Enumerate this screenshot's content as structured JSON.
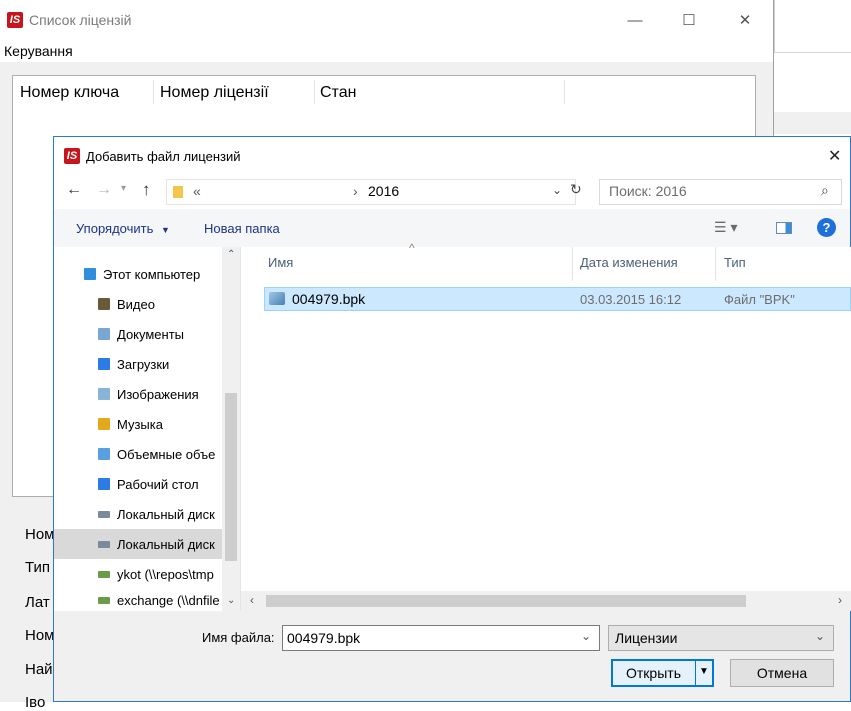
{
  "parent_window": {
    "title": "Список ліцензій",
    "menu": [
      "Керування"
    ],
    "columns": [
      "Номер ключа",
      "Номер ліцензії",
      "Стан"
    ],
    "field_labels": [
      "Ном",
      "Тип",
      "Лат",
      "Ном",
      "Най",
      "Іво"
    ],
    "caption_buttons": {
      "minimize": "—",
      "maximize": "☐",
      "close": "✕"
    }
  },
  "dialog": {
    "title": "Добавить файл лицензий",
    "close": "✕",
    "address": {
      "prefix": "«",
      "separator": "›",
      "current": "2016",
      "search_placeholder": "Поиск: 2016"
    },
    "toolbar": {
      "organize": "Упорядочить",
      "new_folder": "Новая папка"
    },
    "nav_items": [
      {
        "label": "Этот компьютер",
        "icon": "computer-icon",
        "color": "#2f8fdd"
      },
      {
        "label": "Видео",
        "icon": "video-folder-icon",
        "color": "#6a5a3c"
      },
      {
        "label": "Документы",
        "icon": "documents-folder-icon",
        "color": "#7aa6d2"
      },
      {
        "label": "Загрузки",
        "icon": "downloads-folder-icon",
        "color": "#2b7be4"
      },
      {
        "label": "Изображения",
        "icon": "images-folder-icon",
        "color": "#88b4d8"
      },
      {
        "label": "Музыка",
        "icon": "music-folder-icon",
        "color": "#e3a81b"
      },
      {
        "label": "Объемные объе",
        "icon": "3d-objects-folder-icon",
        "color": "#5aa0e0"
      },
      {
        "label": "Рабочий стол",
        "icon": "desktop-folder-icon",
        "color": "#2b7be4"
      },
      {
        "label": "Локальный диск",
        "icon": "local-disk-icon",
        "color": "#7b8a9a"
      },
      {
        "label": "Локальный диск",
        "icon": "local-disk-icon",
        "color": "#7b8a9a"
      },
      {
        "label": "ykot (\\\\repos\\tmp",
        "icon": "network-drive-icon",
        "color": "#6a9a4a"
      },
      {
        "label": "exchange (\\\\dnfile",
        "icon": "network-drive-icon",
        "color": "#6a9a4a"
      }
    ],
    "columns": {
      "name": "Имя",
      "date": "Дата изменения",
      "type": "Тип"
    },
    "files": [
      {
        "name": "004979.bpk",
        "date": "03.03.2015 16:12",
        "type": "Файл \"BPK\""
      }
    ],
    "filename_label": "Имя файла:",
    "filename_value": "004979.bpk",
    "filter": "Лицензии",
    "open_button": "Открыть",
    "cancel_button": "Отмена",
    "accent": "#2b78d6",
    "selection_color": "#cce8ff"
  }
}
